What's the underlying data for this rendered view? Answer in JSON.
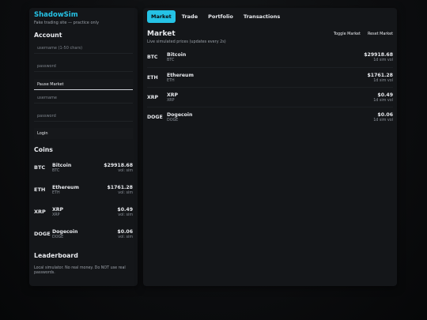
{
  "sidebar": {
    "brand": "ShadowSim",
    "tagline": "Fake trading site — practice only",
    "account_title": "Account",
    "username_placeholder_1": "username (1-50 chars)",
    "password_placeholder_1": "password",
    "pause_label": "Pause Market",
    "username_placeholder_2": "username",
    "password_placeholder_2": "password",
    "login_label": "Login",
    "coins_title": "Coins",
    "coins": [
      {
        "badge": "BTC",
        "name": "Bitcoin",
        "symbol": "BTC",
        "price": "$29918.68",
        "vol": "vol: sim"
      },
      {
        "badge": "ETH",
        "name": "Ethereum",
        "symbol": "ETH",
        "price": "$1761.28",
        "vol": "vol: sim"
      },
      {
        "badge": "XRP",
        "name": "XRP",
        "symbol": "XRP",
        "price": "$0.49",
        "vol": "vol: sim"
      },
      {
        "badge": "DOGE",
        "name": "Dogecoin",
        "symbol": "DOGE",
        "price": "$0.06",
        "vol": "vol: sim"
      }
    ],
    "leaderboard_title": "Leaderboard",
    "disclaimer": "Local simulator. No real money. Do NOT use real passwords."
  },
  "tabs": [
    {
      "label": "Market",
      "active": true
    },
    {
      "label": "Trade",
      "active": false
    },
    {
      "label": "Portfolio",
      "active": false
    },
    {
      "label": "Transactions",
      "active": false
    }
  ],
  "market": {
    "title": "Market",
    "subtitle": "Live simulated prices (updates every 2s)",
    "toggle_label": "Toggle Market",
    "reset_label": "Reset Market",
    "rows": [
      {
        "badge": "BTC",
        "name": "Bitcoin",
        "symbol": "BTC",
        "price": "$29918.68",
        "vol": "1d sim vol"
      },
      {
        "badge": "ETH",
        "name": "Ethereum",
        "symbol": "ETH",
        "price": "$1761.28",
        "vol": "1d sim vol"
      },
      {
        "badge": "XRP",
        "name": "XRP",
        "symbol": "XRP",
        "price": "$0.49",
        "vol": "1d sim vol"
      },
      {
        "badge": "DOGE",
        "name": "Dogecoin",
        "symbol": "DOGE",
        "price": "$0.06",
        "vol": "1d sim vol"
      }
    ]
  },
  "colors": {
    "accent": "#25c3e6",
    "panel": "#141619",
    "background": "#0c0d0f"
  }
}
